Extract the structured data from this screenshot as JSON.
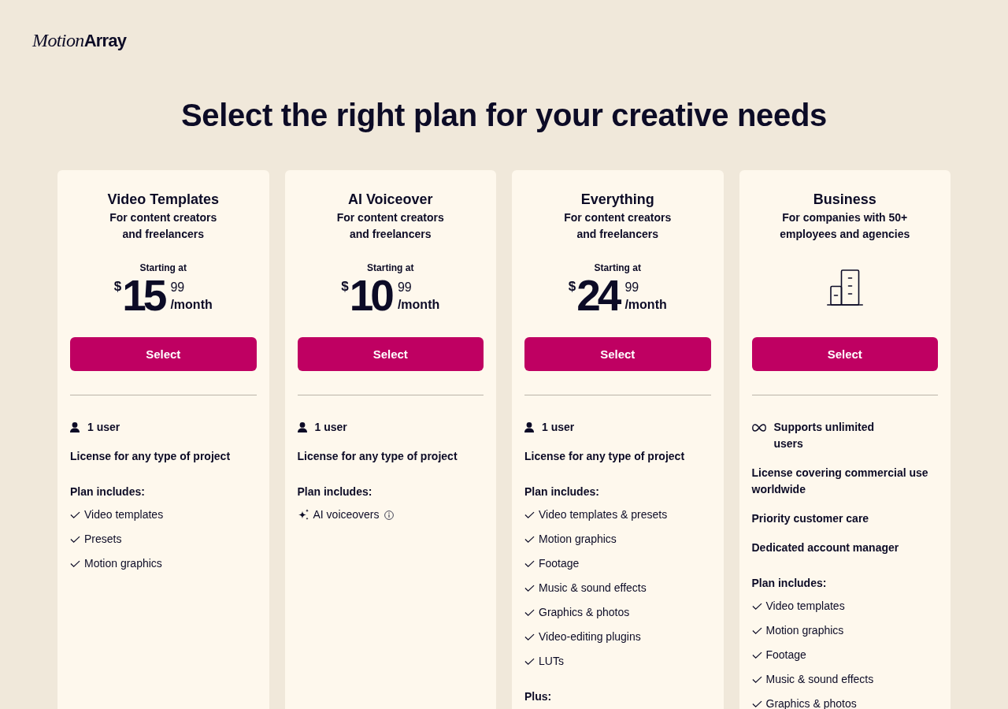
{
  "logo": [
    "Motion",
    "Array"
  ],
  "heading": "Select the right plan for your creative needs",
  "plans": [
    {
      "kind": "priced",
      "name": "Video Templates",
      "audience": "For content creators\nand freelancers",
      "price": {
        "label": "Starting at",
        "currency": "$",
        "amount": "15",
        "cents": "99",
        "period": "/month"
      },
      "button": "Select",
      "features": [
        {
          "kind": "users",
          "text": "1 user"
        },
        {
          "kind": "text",
          "text": "License for any type of project"
        }
      ],
      "sections": [
        {
          "heading": "Plan includes:",
          "items": [
            {
              "kind": "check",
              "text": "Video templates"
            },
            {
              "kind": "check",
              "text": "Presets"
            },
            {
              "kind": "check",
              "text": "Motion graphics"
            }
          ]
        }
      ]
    },
    {
      "kind": "priced",
      "name": "AI Voiceover",
      "audience": "For content creators\nand freelancers",
      "price": {
        "label": "Starting at",
        "currency": "$",
        "amount": "10",
        "cents": "99",
        "period": "/month"
      },
      "button": "Select",
      "features": [
        {
          "kind": "users",
          "text": "1 user"
        },
        {
          "kind": "text",
          "text": "License for any type of project"
        }
      ],
      "sections": [
        {
          "heading": "Plan includes:",
          "items": [
            {
              "kind": "ai",
              "text": "AI voiceovers"
            }
          ]
        }
      ]
    },
    {
      "kind": "priced",
      "name": "Everything",
      "audience": "For content creators\nand freelancers",
      "price": {
        "label": "Starting at",
        "currency": "$",
        "amount": "24",
        "cents": "99",
        "period": "/month"
      },
      "button": "Select",
      "features": [
        {
          "kind": "users",
          "text": "1 user"
        },
        {
          "kind": "text",
          "text": "License for any type of project"
        }
      ],
      "sections": [
        {
          "heading": "Plan includes:",
          "items": [
            {
              "kind": "check",
              "text": "Video templates & presets"
            },
            {
              "kind": "check",
              "text": "Motion graphics"
            },
            {
              "kind": "check",
              "text": "Footage"
            },
            {
              "kind": "check",
              "text": "Music & sound effects"
            },
            {
              "kind": "check",
              "text": "Graphics & photos"
            },
            {
              "kind": "check",
              "text": "Video-editing plugins"
            },
            {
              "kind": "check",
              "text": "LUTs"
            }
          ]
        },
        {
          "heading": "Plus:"
        }
      ]
    },
    {
      "kind": "business",
      "name": "Business",
      "audience": "For companies with 50+\nemployees and agencies",
      "button": "Select",
      "features": [
        {
          "kind": "unlimited",
          "text": "Supports unlimited\nusers"
        },
        {
          "kind": "text",
          "text": "License covering commercial use worldwide"
        },
        {
          "kind": "text",
          "text": "Priority customer care"
        },
        {
          "kind": "text",
          "text": "Dedicated account manager"
        }
      ],
      "sections": [
        {
          "heading": "Plan includes:",
          "items": [
            {
              "kind": "check",
              "text": "Video templates"
            },
            {
              "kind": "check",
              "text": "Motion graphics"
            },
            {
              "kind": "check",
              "text": "Footage"
            },
            {
              "kind": "check",
              "text": "Music & sound effects"
            },
            {
              "kind": "check",
              "text": "Graphics & photos"
            }
          ]
        }
      ]
    }
  ]
}
